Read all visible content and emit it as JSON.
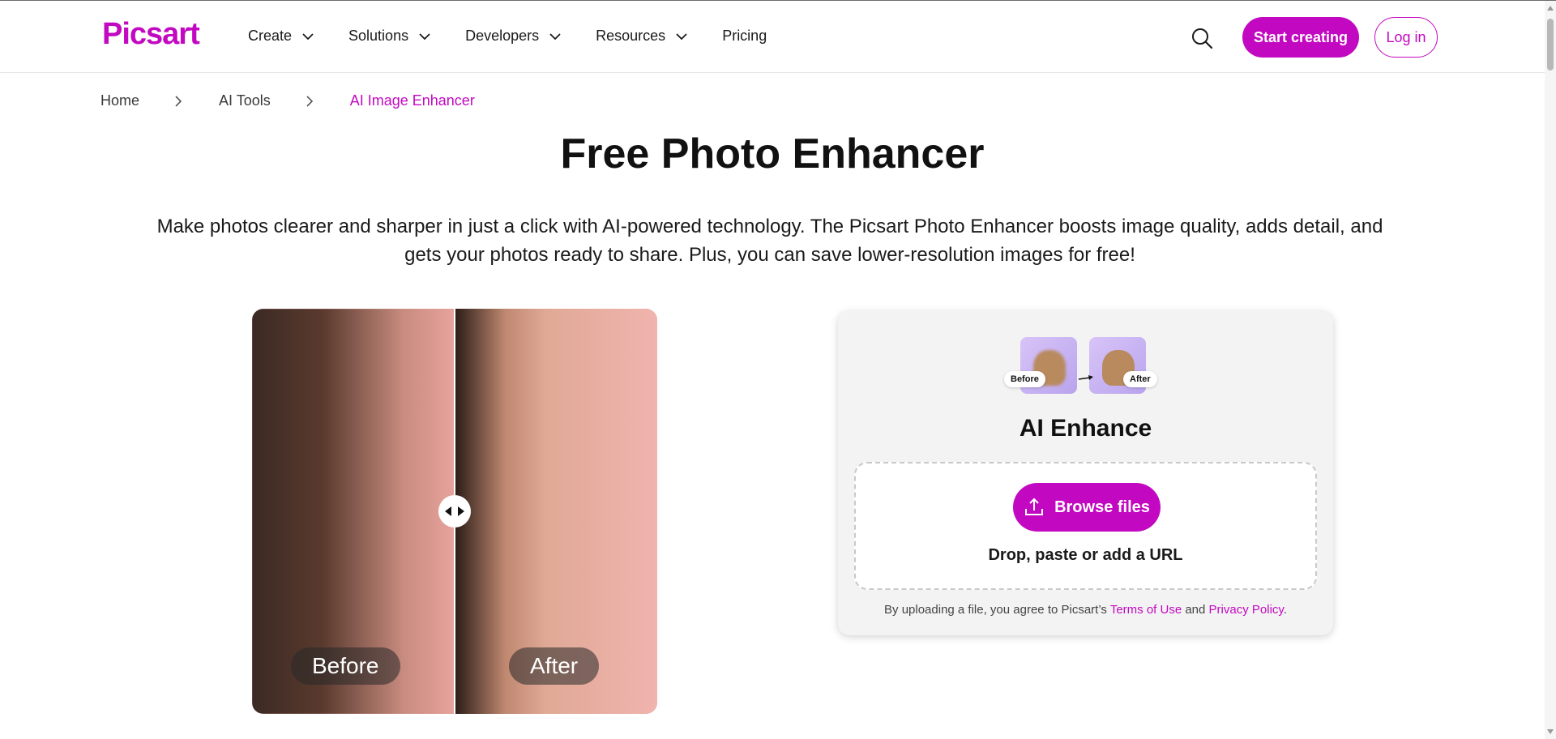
{
  "header": {
    "logo": "Picsart",
    "nav": [
      {
        "label": "Create"
      },
      {
        "label": "Solutions"
      },
      {
        "label": "Developers"
      },
      {
        "label": "Resources"
      },
      {
        "label": "Pricing"
      }
    ],
    "start_label": "Start creating",
    "login_label": "Log in"
  },
  "breadcrumb": [
    {
      "label": "Home"
    },
    {
      "label": "AI Tools"
    },
    {
      "label": "AI Image Enhancer"
    }
  ],
  "main": {
    "title": "Free Photo Enhancer",
    "description": "Make photos clearer and sharper in just a click with AI-powered technology. The Picsart Photo Enhancer boosts image quality, adds detail, and gets your photos ready to share. Plus, you can save lower-resolution images for free!",
    "compare": {
      "before_label": "Before",
      "after_label": "After"
    }
  },
  "upload_card": {
    "thumb_before": "Before",
    "thumb_after": "After",
    "title": "AI Enhance",
    "browse_label": "Browse files",
    "drop_text": "Drop, paste or add a URL",
    "terms_prefix": "By uploading a file, you agree to Picsart’s",
    "terms_link": "Terms of Use",
    "terms_and": "and",
    "privacy_link": "Privacy Policy",
    "terms_suffix": "."
  },
  "colors": {
    "brand": "#c209c1"
  }
}
